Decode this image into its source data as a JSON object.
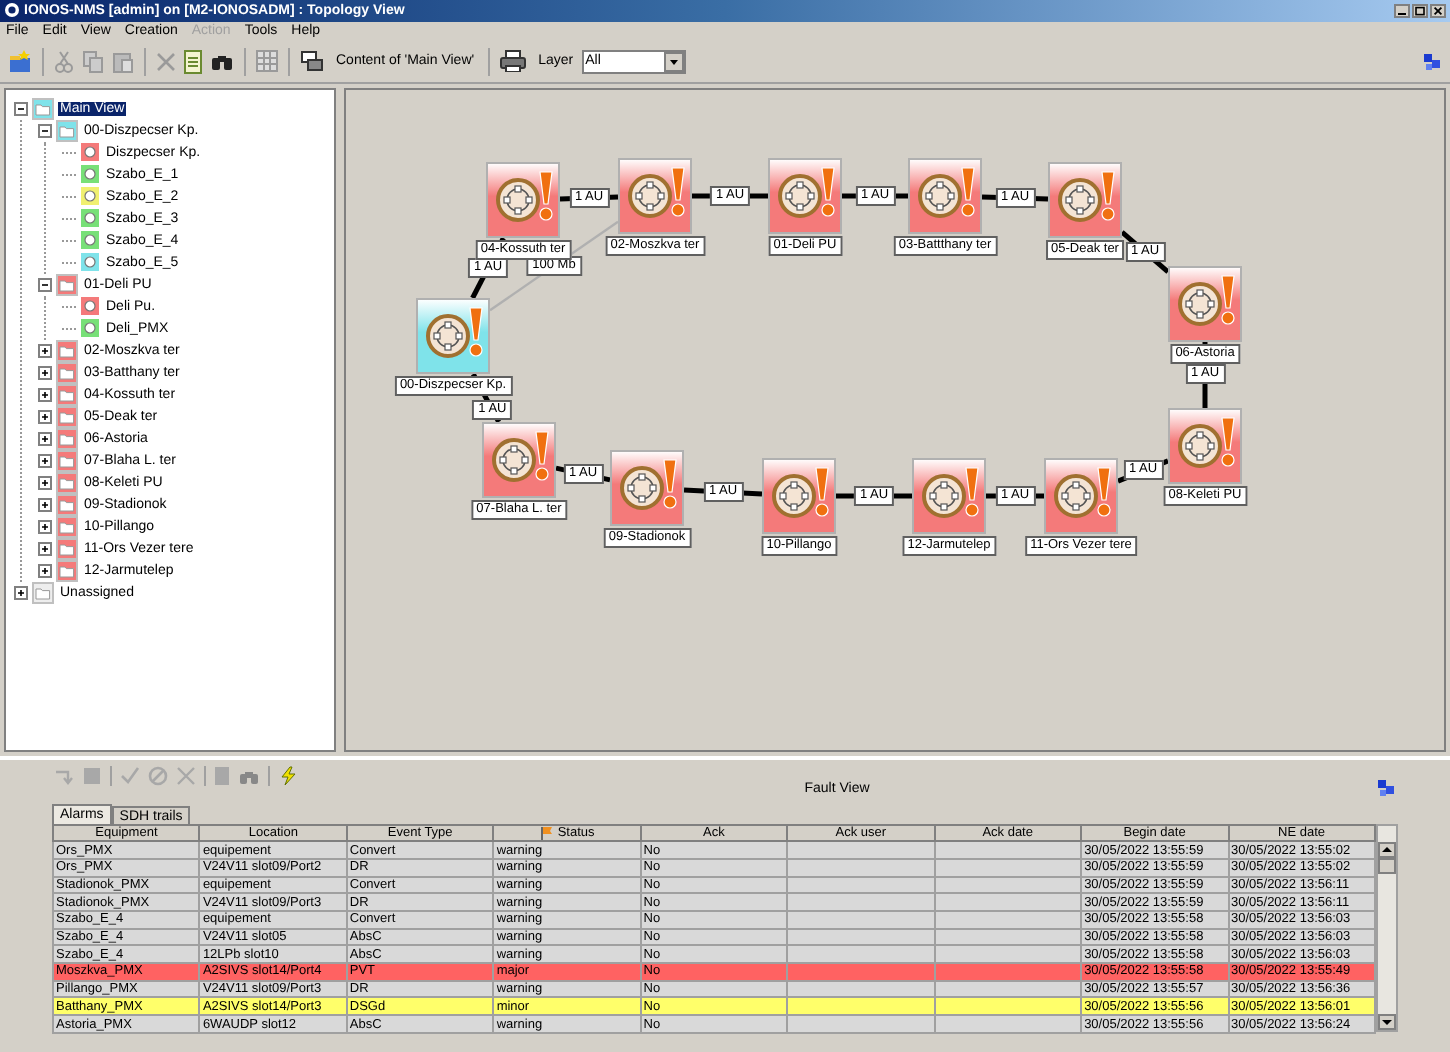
{
  "window": {
    "title": "IONOS-NMS [admin] on [M2-IONOSADM] : Topology View"
  },
  "menu": [
    {
      "label": "File",
      "disabled": false
    },
    {
      "label": "Edit",
      "disabled": false
    },
    {
      "label": "View",
      "disabled": false
    },
    {
      "label": "Creation",
      "disabled": false
    },
    {
      "label": "Action",
      "disabled": true
    },
    {
      "label": "Tools",
      "disabled": false
    },
    {
      "label": "Help",
      "disabled": false
    }
  ],
  "toolbar": {
    "content_button": "Content of 'Main View'",
    "layer_label": "Layer",
    "layer_value": "All"
  },
  "tree": [
    {
      "label": "Main View",
      "kind": "folder",
      "color": "#7fe3ea",
      "selected": true,
      "expanded": true,
      "children": [
        {
          "label": "00-Diszpecser Kp.",
          "kind": "folder",
          "color": "#7fe3ea",
          "selected": false,
          "expanded": true,
          "children": [
            {
              "label": "Diszpecser Kp.",
              "kind": "device",
              "color": "#f47a7a"
            },
            {
              "label": "Szabo_E_1",
              "kind": "device",
              "color": "#78e078"
            },
            {
              "label": "Szabo_E_2",
              "kind": "device",
              "color": "#f0f070"
            },
            {
              "label": "Szabo_E_3",
              "kind": "device",
              "color": "#78e078"
            },
            {
              "label": "Szabo_E_4",
              "kind": "device",
              "color": "#78e078"
            },
            {
              "label": "Szabo_E_5",
              "kind": "device",
              "color": "#7fe3ea"
            }
          ]
        },
        {
          "label": "01-Deli PU",
          "kind": "folder",
          "color": "#f47a7a",
          "selected": false,
          "expanded": true,
          "children": [
            {
              "label": "Deli Pu.",
              "kind": "device",
              "color": "#f47a7a"
            },
            {
              "label": "Deli_PMX",
              "kind": "device",
              "color": "#78e078"
            }
          ]
        },
        {
          "label": "02-Moszkva ter",
          "kind": "folder",
          "color": "#f47a7a",
          "selected": false,
          "expanded": false
        },
        {
          "label": "03-Batthany ter",
          "kind": "folder",
          "color": "#f47a7a",
          "selected": false,
          "expanded": false
        },
        {
          "label": "04-Kossuth ter",
          "kind": "folder",
          "color": "#f47a7a",
          "selected": false,
          "expanded": false
        },
        {
          "label": "05-Deak ter",
          "kind": "folder",
          "color": "#f47a7a",
          "selected": false,
          "expanded": false
        },
        {
          "label": "06-Astoria",
          "kind": "folder",
          "color": "#f47a7a",
          "selected": false,
          "expanded": false
        },
        {
          "label": "07-Blaha L. ter",
          "kind": "folder",
          "color": "#f47a7a",
          "selected": false,
          "expanded": false
        },
        {
          "label": "08-Keleti PU",
          "kind": "folder",
          "color": "#f47a7a",
          "selected": false,
          "expanded": false
        },
        {
          "label": "09-Stadionok",
          "kind": "folder",
          "color": "#f47a7a",
          "selected": false,
          "expanded": false
        },
        {
          "label": "10-Pillango",
          "kind": "folder",
          "color": "#f47a7a",
          "selected": false,
          "expanded": false
        },
        {
          "label": "11-Ors Vezer tere",
          "kind": "folder",
          "color": "#f47a7a",
          "selected": false,
          "expanded": false
        },
        {
          "label": "12-Jarmutelep",
          "kind": "folder",
          "color": "#f47a7a",
          "selected": false,
          "expanded": false
        }
      ]
    },
    {
      "label": "Unassigned",
      "kind": "folder",
      "color": "#eeeeee",
      "selected": false,
      "expanded": false
    }
  ],
  "topology": {
    "nodes": [
      {
        "label": "04-Kossuth ter",
        "color": "#f47a7a"
      },
      {
        "label": "02-Moszkva ter",
        "color": "#f47a7a"
      },
      {
        "label": "01-Deli PU",
        "color": "#f47a7a"
      },
      {
        "label": "03-Battthany ter",
        "color": "#f47a7a"
      },
      {
        "label": "05-Deak ter",
        "color": "#f47a7a"
      },
      {
        "label": "06-Astoria",
        "color": "#f47a7a"
      },
      {
        "label": "00-Diszpecser Kp.",
        "color": "#7fe3ea"
      },
      {
        "label": "07-Blaha L. ter",
        "color": "#f47a7a"
      },
      {
        "label": "09-Stadionok",
        "color": "#f47a7a"
      },
      {
        "label": "10-Pillango",
        "color": "#f47a7a"
      },
      {
        "label": "12-Jarmutelep",
        "color": "#f47a7a"
      },
      {
        "label": "11-Ors Vezer tere",
        "color": "#f47a7a"
      },
      {
        "label": "08-Keleti PU",
        "color": "#f47a7a"
      }
    ],
    "links": [
      {
        "label": "1 AU",
        "kind": "thick"
      },
      {
        "label": "1 AU",
        "kind": "thick"
      },
      {
        "label": "1 AU",
        "kind": "thick"
      },
      {
        "label": "1 AU",
        "kind": "thick"
      },
      {
        "label": "1 AU",
        "kind": "thick"
      },
      {
        "label": "1 AU",
        "kind": "thick"
      },
      {
        "label": "1 AU",
        "kind": "thick"
      },
      {
        "label": "100 Mb",
        "kind": "thin"
      },
      {
        "label": "1 AU",
        "kind": "thick"
      },
      {
        "label": "1 AU",
        "kind": "thick"
      },
      {
        "label": "1 AU",
        "kind": "thick"
      },
      {
        "label": "1 AU",
        "kind": "thick"
      },
      {
        "label": "1 AU",
        "kind": "thick"
      },
      {
        "label": "1 AU",
        "kind": "thick"
      }
    ]
  },
  "fault_view": {
    "title": "Fault View",
    "tabs": [
      {
        "label": "Alarms",
        "selected": true
      },
      {
        "label": "SDH trails",
        "selected": false
      }
    ],
    "columns": [
      "Equipment",
      "Location",
      "Event Type",
      "Status",
      "Ack",
      "Ack user",
      "Ack date",
      "Begin date",
      "NE date"
    ],
    "rows": [
      {
        "color": "#d9d9d9",
        "cells": [
          "Ors_PMX",
          "equipement",
          "Convert",
          "warning",
          "No",
          "",
          "",
          "30/05/2022 13:55:59",
          "30/05/2022 13:55:02"
        ]
      },
      {
        "color": "#d9d9d9",
        "cells": [
          "Ors_PMX",
          "V24V11 slot09/Port2",
          "DR",
          "warning",
          "No",
          "",
          "",
          "30/05/2022 13:55:59",
          "30/05/2022 13:55:02"
        ]
      },
      {
        "color": "#d9d9d9",
        "cells": [
          "Stadionok_PMX",
          "equipement",
          "Convert",
          "warning",
          "No",
          "",
          "",
          "30/05/2022 13:55:59",
          "30/05/2022 13:56:11"
        ]
      },
      {
        "color": "#d9d9d9",
        "cells": [
          "Stadionok_PMX",
          "V24V11 slot09/Port3",
          "DR",
          "warning",
          "No",
          "",
          "",
          "30/05/2022 13:55:59",
          "30/05/2022 13:56:11"
        ]
      },
      {
        "color": "#d9d9d9",
        "cells": [
          "Szabo_E_4",
          "equipement",
          "Convert",
          "warning",
          "No",
          "",
          "",
          "30/05/2022 13:55:58",
          "30/05/2022 13:56:03"
        ]
      },
      {
        "color": "#d9d9d9",
        "cells": [
          "Szabo_E_4",
          "V24V11 slot05",
          "AbsC",
          "warning",
          "No",
          "",
          "",
          "30/05/2022 13:55:58",
          "30/05/2022 13:56:03"
        ]
      },
      {
        "color": "#d9d9d9",
        "cells": [
          "Szabo_E_4",
          "12LPb slot10",
          "AbsC",
          "warning",
          "No",
          "",
          "",
          "30/05/2022 13:55:58",
          "30/05/2022 13:56:03"
        ]
      },
      {
        "color": "#ff6262",
        "cells": [
          "Moszkva_PMX",
          "A2SIVS slot14/Port4",
          "PVT",
          "major",
          "No",
          "",
          "",
          "30/05/2022 13:55:58",
          "30/05/2022 13:55:49"
        ]
      },
      {
        "color": "#d9d9d9",
        "cells": [
          "Pillango_PMX",
          "V24V11 slot09/Port3",
          "DR",
          "warning",
          "No",
          "",
          "",
          "30/05/2022 13:55:57",
          "30/05/2022 13:56:36"
        ]
      },
      {
        "color": "#ffff6a",
        "cells": [
          "Batthany_PMX",
          "A2SIVS slot14/Port3",
          "DSGd",
          "minor",
          "No",
          "",
          "",
          "30/05/2022 13:55:56",
          "30/05/2022 13:56:01"
        ]
      },
      {
        "color": "#d9d9d9",
        "cells": [
          "Astoria_PMX",
          "6WAUDP slot12",
          "AbsC",
          "warning",
          "No",
          "",
          "",
          "30/05/2022 13:55:56",
          "30/05/2022 13:56:24"
        ]
      }
    ]
  }
}
